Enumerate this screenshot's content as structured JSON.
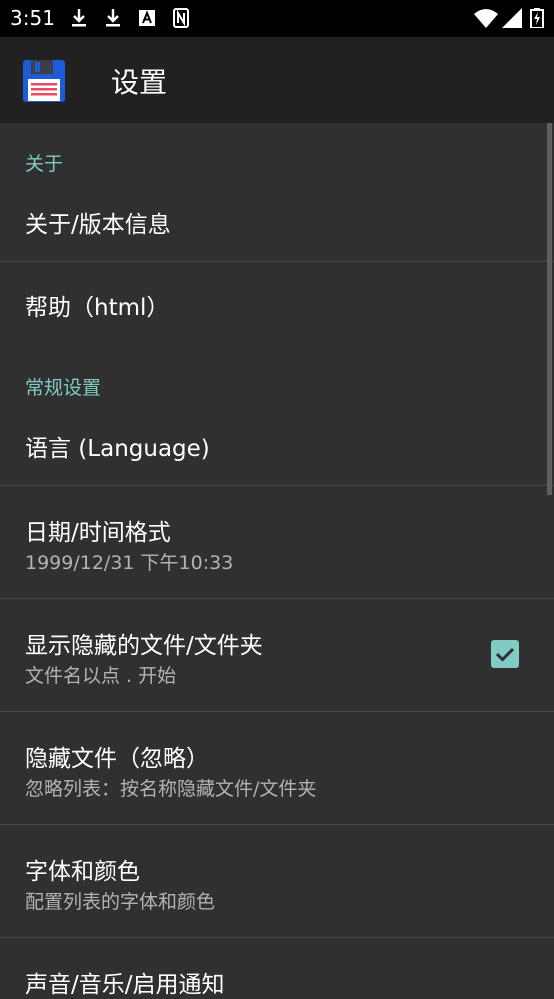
{
  "status_bar": {
    "time": "3:51",
    "icons": [
      "download-icon",
      "download-icon",
      "a-notification-icon",
      "n-notification-icon",
      "wifi-icon",
      "signal-icon",
      "battery-charging-icon"
    ]
  },
  "app_bar": {
    "title": "设置",
    "icon": "floppy-disk-icon"
  },
  "sections": {
    "about": {
      "header": "关于",
      "about_version": "关于/版本信息",
      "help": "帮助（html）"
    },
    "general": {
      "header": "常规设置",
      "language": "语言 (Language)",
      "datetime_title": "日期/时间格式",
      "datetime_summary": "1999/12/31  下午10:33",
      "hidden_title": "显示隐藏的文件/文件夹",
      "hidden_summary": "文件名以点 . 开始",
      "hidden_checked": true,
      "ignore_title": "隐藏文件（忽略）",
      "ignore_summary": "忽略列表：按名称隐藏文件/文件夹",
      "font_title": "字体和颜色",
      "font_summary": "配置列表的字体和颜色",
      "sound_title": "声音/音乐/启用通知"
    }
  },
  "colors": {
    "accent": "#80cbc4",
    "background": "#303030",
    "appbar": "#212121"
  }
}
